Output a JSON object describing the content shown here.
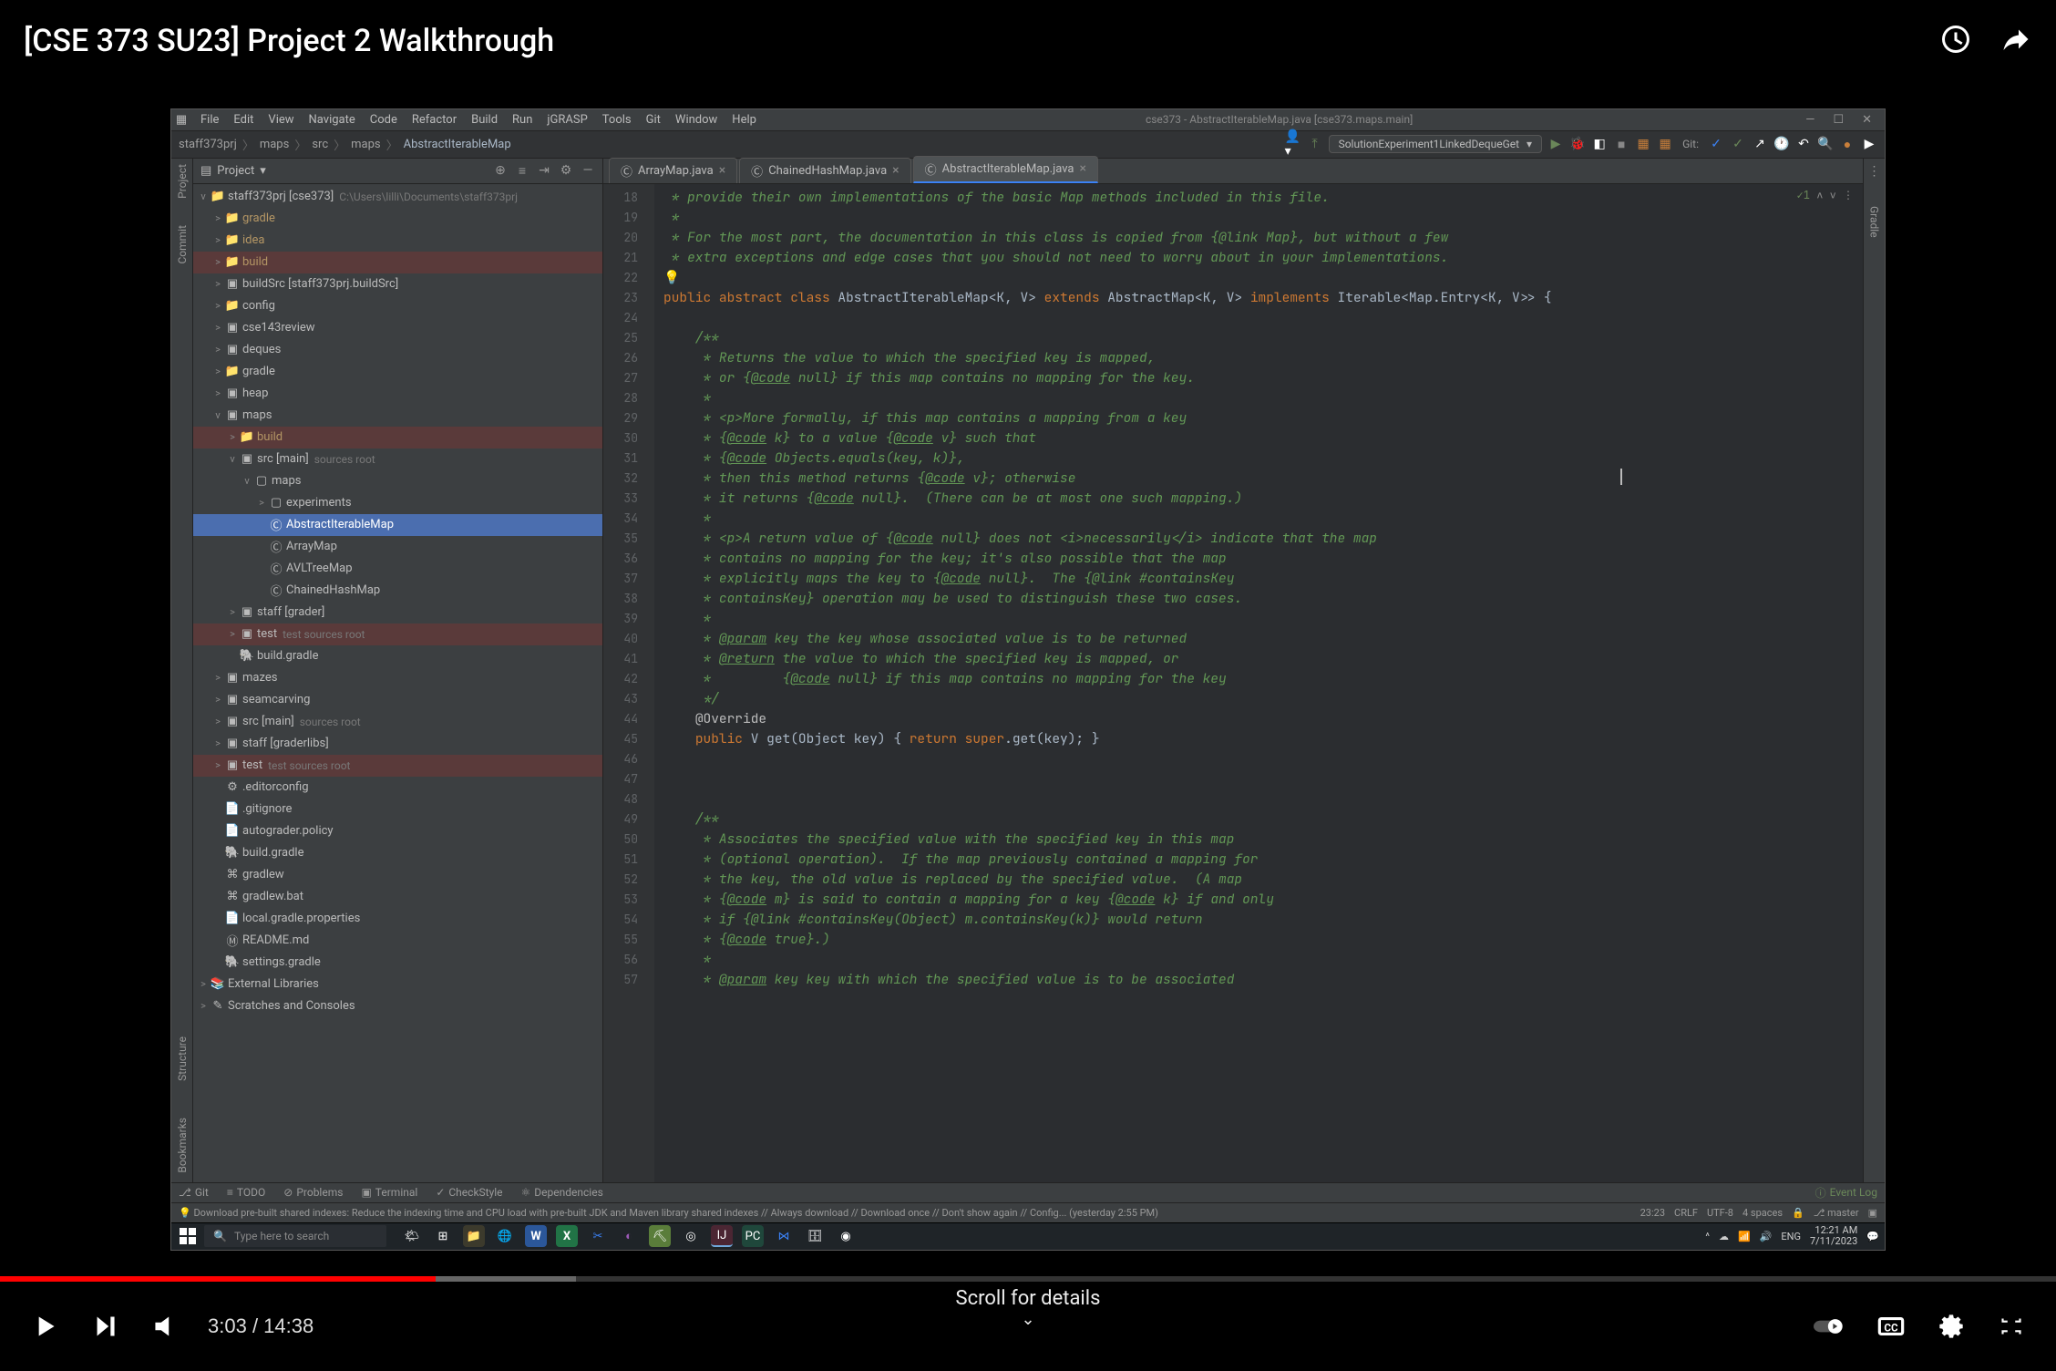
{
  "video_title": "[CSE 373 SU23] Project 2 Walkthrough",
  "scroll_hint": "Scroll for details",
  "time_current": "3:03",
  "time_total": "14:38",
  "ide": {
    "menu": [
      "File",
      "Edit",
      "View",
      "Navigate",
      "Code",
      "Refactor",
      "Build",
      "Run",
      "jGRASP",
      "Tools",
      "Git",
      "Window",
      "Help"
    ],
    "title": "cse373 - AbstractIterableMap.java [cse373.maps.main]",
    "breadcrumbs": [
      "staff373prj",
      "maps",
      "src",
      "maps",
      "AbstractIterableMap"
    ],
    "run_config": "SolutionExperiment1LinkedDequeGet",
    "project_label": "Project",
    "tree": [
      {
        "d": 0,
        "chev": "v",
        "ico": "dir",
        "label": "staff373prj [cse373]",
        "hint": "C:\\Users\\lilli\\Documents\\staff373prj"
      },
      {
        "d": 1,
        "chev": ">",
        "ico": "dir",
        "label": "gradle",
        "dim": true
      },
      {
        "d": 1,
        "chev": ">",
        "ico": "dir",
        "label": "idea",
        "dim": true
      },
      {
        "d": 1,
        "chev": ">",
        "ico": "dir",
        "label": "build",
        "cls": "hl-red dim"
      },
      {
        "d": 1,
        "chev": ">",
        "ico": "mod",
        "label": "buildSrc [staff373prj.buildSrc]"
      },
      {
        "d": 1,
        "chev": ">",
        "ico": "dir",
        "label": "config"
      },
      {
        "d": 1,
        "chev": ">",
        "ico": "mod",
        "label": "cse143review"
      },
      {
        "d": 1,
        "chev": ">",
        "ico": "mod",
        "label": "deques"
      },
      {
        "d": 1,
        "chev": ">",
        "ico": "dir",
        "label": "gradle"
      },
      {
        "d": 1,
        "chev": ">",
        "ico": "mod",
        "label": "heap"
      },
      {
        "d": 1,
        "chev": "v",
        "ico": "mod",
        "label": "maps"
      },
      {
        "d": 2,
        "chev": ">",
        "ico": "dir",
        "label": "build",
        "cls": "hl-red dim"
      },
      {
        "d": 2,
        "chev": "v",
        "ico": "src",
        "label": "src [main]",
        "hint": "sources root"
      },
      {
        "d": 3,
        "chev": "v",
        "ico": "pkg",
        "label": "maps"
      },
      {
        "d": 4,
        "chev": ">",
        "ico": "pkg",
        "label": "experiments"
      },
      {
        "d": 4,
        "chev": "",
        "ico": "cls",
        "label": "AbstractIterableMap",
        "cls": "sel"
      },
      {
        "d": 4,
        "chev": "",
        "ico": "cls",
        "label": "ArrayMap"
      },
      {
        "d": 4,
        "chev": "",
        "ico": "cls",
        "label": "AVLTreeMap"
      },
      {
        "d": 4,
        "chev": "",
        "ico": "cls",
        "label": "ChainedHashMap"
      },
      {
        "d": 2,
        "chev": ">",
        "ico": "mod",
        "label": "staff [grader]"
      },
      {
        "d": 2,
        "chev": ">",
        "ico": "tst",
        "label": "test",
        "hint": "test sources root",
        "cls": "hl-red"
      },
      {
        "d": 2,
        "chev": "",
        "ico": "gr",
        "label": "build.gradle"
      },
      {
        "d": 1,
        "chev": ">",
        "ico": "mod",
        "label": "mazes"
      },
      {
        "d": 1,
        "chev": ">",
        "ico": "mod",
        "label": "seamcarving"
      },
      {
        "d": 1,
        "chev": ">",
        "ico": "mod",
        "label": "src [main]",
        "hint": "sources root"
      },
      {
        "d": 1,
        "chev": ">",
        "ico": "mod",
        "label": "staff [graderlibs]"
      },
      {
        "d": 1,
        "chev": ">",
        "ico": "tst",
        "label": "test",
        "hint": "test sources root",
        "cls": "hl-red"
      },
      {
        "d": 1,
        "chev": "",
        "ico": "cfg",
        "label": ".editorconfig"
      },
      {
        "d": 1,
        "chev": "",
        "ico": "txt",
        "label": ".gitignore"
      },
      {
        "d": 1,
        "chev": "",
        "ico": "txt",
        "label": "autograder.policy"
      },
      {
        "d": 1,
        "chev": "",
        "ico": "gr",
        "label": "build.gradle"
      },
      {
        "d": 1,
        "chev": "",
        "ico": "sh",
        "label": "gradlew"
      },
      {
        "d": 1,
        "chev": "",
        "ico": "bat",
        "label": "gradlew.bat"
      },
      {
        "d": 1,
        "chev": "",
        "ico": "txt",
        "label": "local.gradle.properties"
      },
      {
        "d": 1,
        "chev": "",
        "ico": "md",
        "label": "README.md"
      },
      {
        "d": 1,
        "chev": "",
        "ico": "gr",
        "label": "settings.gradle"
      },
      {
        "d": 0,
        "chev": ">",
        "ico": "lib",
        "label": "External Libraries"
      },
      {
        "d": 0,
        "chev": ">",
        "ico": "sc",
        "label": "Scratches and Consoles"
      }
    ],
    "tabs": [
      {
        "label": "ArrayMap.java",
        "active": false
      },
      {
        "label": "ChainedHashMap.java",
        "active": false
      },
      {
        "label": "AbstractIterableMap.java",
        "active": true
      }
    ],
    "check_badge": "✓1",
    "code_start": 18,
    "code": [
      {
        "n": 18,
        "h": " * provide their own implementations of the basic Map methods included in this file.",
        "c": "jdoc"
      },
      {
        "n": 19,
        "h": " *",
        "c": "jdoc"
      },
      {
        "n": 20,
        "h": " * For the most part, the documentation in this class is copied from {<span class='link'>@link Map</span>}, but without a few",
        "c": "jdoc"
      },
      {
        "n": 21,
        "h": " * extra exceptions and edge cases that you should not need to worry about in your implementations.",
        "c": "jdoc"
      },
      {
        "n": 22,
        "h": "<span class='bulb'>💡</span>",
        "c": ""
      },
      {
        "n": 23,
        "h": "<span class='kw'>public abstract class</span> AbstractIterableMap&lt;<span class='type'>K</span>, <span class='type'>V</span>&gt; <span class='kw'>extends</span> AbstractMap&lt;<span class='type'>K</span>, <span class='type'>V</span>&gt; <span class='kw'>implements</span> Iterable&lt;Map.Entry&lt;<span class='type'>K</span>, <span class='type'>V</span>&gt;&gt; {",
        "c": ""
      },
      {
        "n": 24,
        "h": "",
        "c": ""
      },
      {
        "n": 25,
        "h": "    /**",
        "c": "jdoc"
      },
      {
        "n": 26,
        "h": "     * Returns the value to which the specified key is mapped,",
        "c": "jdoc"
      },
      {
        "n": 27,
        "h": "     * or {<span class='jtag'>@code</span> null} if this map contains no mapping for the key.",
        "c": "jdoc"
      },
      {
        "n": 28,
        "h": "     *",
        "c": "jdoc"
      },
      {
        "n": 29,
        "h": "     * &lt;p&gt;More formally, if this map contains a mapping from a key",
        "c": "jdoc"
      },
      {
        "n": 30,
        "h": "     * {<span class='jtag'>@code</span> k} to a value {<span class='jtag'>@code</span> v} such that",
        "c": "jdoc"
      },
      {
        "n": 31,
        "h": "     * {<span class='jtag'>@code</span> Objects.equals(key, k)},",
        "c": "jdoc"
      },
      {
        "n": 32,
        "h": "     * then this method returns {<span class='jtag'>@code</span> v}; otherwise",
        "c": "jdoc"
      },
      {
        "n": 33,
        "h": "     * it returns {<span class='jtag'>@code</span> null}.  (There can be at most one such mapping.)",
        "c": "jdoc"
      },
      {
        "n": 34,
        "h": "     *",
        "c": "jdoc"
      },
      {
        "n": 35,
        "h": "     * &lt;p&gt;A return value of {<span class='jtag'>@code</span> null} does not &lt;i&gt;necessarily&lt;/i&gt; indicate that the map",
        "c": "jdoc"
      },
      {
        "n": 36,
        "h": "     * contains no mapping for the key; it's also possible that the map",
        "c": "jdoc"
      },
      {
        "n": 37,
        "h": "     * explicitly maps the key to {<span class='jtag'>@code</span> null}.  The {<span class='link'>@link #containsKey</span>",
        "c": "jdoc"
      },
      {
        "n": 38,
        "h": "     * containsKey} operation may be used to distinguish these two cases.",
        "c": "jdoc"
      },
      {
        "n": 39,
        "h": "     *",
        "c": "jdoc"
      },
      {
        "n": 40,
        "h": "     * <span class='jtag'>@param</span> key the key whose associated value is to be returned",
        "c": "jdoc"
      },
      {
        "n": 41,
        "h": "     * <span class='jtag'>@return</span> the value to which the specified key is mapped, or",
        "c": "jdoc"
      },
      {
        "n": 42,
        "h": "     *         {<span class='jtag'>@code</span> null} if this map contains no mapping for the key",
        "c": "jdoc"
      },
      {
        "n": 43,
        "h": "     */",
        "c": "jdoc"
      },
      {
        "n": 44,
        "h": "    <span class='ann'>@Override</span>",
        "c": ""
      },
      {
        "n": 45,
        "h": "    <span class='kw'>public</span> V get(Object key) { <span class='kw'>return</span> <span class='kw'>super</span>.get(key); }",
        "c": ""
      },
      {
        "n": 46,
        "h": "",
        "c": ""
      },
      {
        "n": 47,
        "h": "",
        "c": ""
      },
      {
        "n": 48,
        "h": "",
        "c": ""
      },
      {
        "n": 49,
        "h": "    /**",
        "c": "jdoc"
      },
      {
        "n": 50,
        "h": "     * Associates the specified value with the specified key in this map",
        "c": "jdoc"
      },
      {
        "n": 51,
        "h": "     * (optional operation).  If the map previously contained a mapping for",
        "c": "jdoc"
      },
      {
        "n": 52,
        "h": "     * the key, the old value is replaced by the specified value.  (A map",
        "c": "jdoc"
      },
      {
        "n": 53,
        "h": "     * {<span class='jtag'>@code</span> m} is said to contain a mapping for a key {<span class='jtag'>@code</span> k} if and only",
        "c": "jdoc"
      },
      {
        "n": 54,
        "h": "     * if {<span class='link'>@link #containsKey(Object) m.containsKey(k)</span>} would return",
        "c": "jdoc"
      },
      {
        "n": 55,
        "h": "     * {<span class='jtag'>@code</span> true}.)",
        "c": "jdoc"
      },
      {
        "n": 56,
        "h": "     *",
        "c": "jdoc"
      },
      {
        "n": 57,
        "h": "     * <span class='jtag'>@param</span> key key with which the specified value is to be associated",
        "c": "jdoc"
      }
    ],
    "bottom_tabs": [
      "Git",
      "TODO",
      "Problems",
      "Terminal",
      "CheckStyle",
      "Dependencies"
    ],
    "event_log": "Event Log",
    "alert": "Download pre-built shared indexes: Reduce the indexing time and CPU load with pre-built JDK and Maven library shared indexes // Always download // Download once // Don't show again // Config... (yesterday 2:55 PM)",
    "status": {
      "cursor": "23:23",
      "eol": "CRLF",
      "enc": "UTF-8",
      "indent": "4 spaces",
      "branch": "master"
    },
    "taskbar": {
      "search_placeholder": "Type here to search",
      "tray_lang": "ENG",
      "clock_time": "12:21 AM",
      "clock_date": "7/11/2023"
    }
  }
}
